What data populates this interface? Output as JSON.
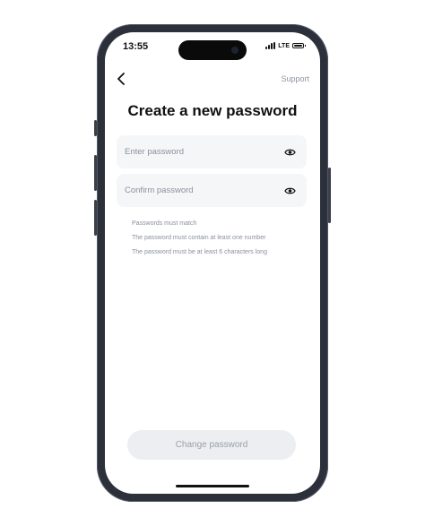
{
  "status_bar": {
    "time": "13:55",
    "network": "LTE",
    "battery_level": 1.0
  },
  "nav": {
    "back_icon": "chevron-left-icon",
    "support_label": "Support"
  },
  "title": "Create a new password",
  "fields": {
    "password": {
      "placeholder": "Enter password",
      "value": "",
      "toggle_icon": "eye-icon"
    },
    "confirm": {
      "placeholder": "Confirm password",
      "value": "",
      "toggle_icon": "eye-icon"
    }
  },
  "rules": [
    "Passwords must match",
    "The password must contain at least one number",
    "The password must be at least 6 characters long"
  ],
  "submit_label": "Change password",
  "colors": {
    "frame": "#2b303a",
    "field_bg": "#f5f6f8",
    "muted_text": "#8a909c",
    "button_bg": "#eceef1",
    "button_text": "#9aa0ab"
  }
}
